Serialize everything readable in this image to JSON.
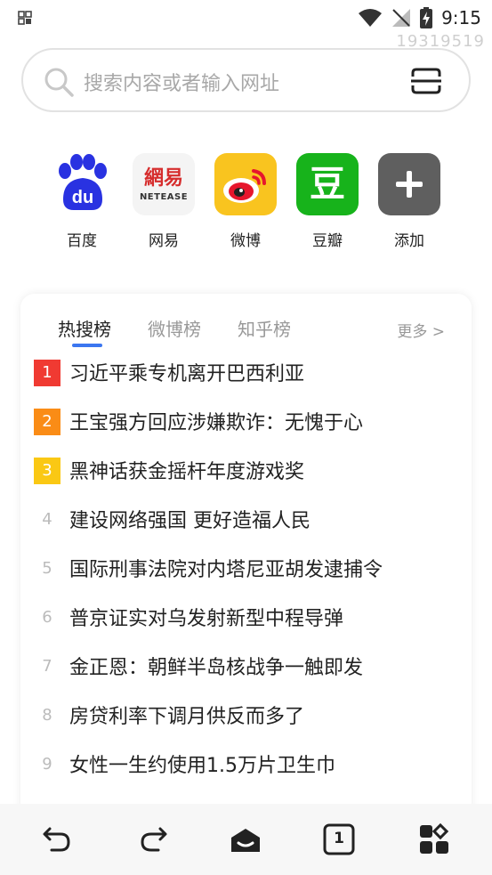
{
  "status_bar": {
    "time": "9:15"
  },
  "watermark": "19319519",
  "search": {
    "placeholder": "搜索内容或者输入网址"
  },
  "shortcuts": [
    {
      "label": "百度",
      "icon": "baidu-icon"
    },
    {
      "label": "网易",
      "icon": "netease-icon",
      "tile_text_top": "網易",
      "tile_text_bottom": "NETEASE"
    },
    {
      "label": "微博",
      "icon": "weibo-icon"
    },
    {
      "label": "豆瓣",
      "icon": "douban-icon",
      "tile_text": "豆"
    },
    {
      "label": "添加",
      "icon": "plus-icon"
    }
  ],
  "hot_list": {
    "tabs": [
      "热搜榜",
      "微博榜",
      "知乎榜"
    ],
    "more": "更多 >",
    "items": [
      {
        "rank": "1",
        "text": "习近平乘专机离开巴西利亚"
      },
      {
        "rank": "2",
        "text": "王宝强方回应涉嫌欺诈：无愧于心"
      },
      {
        "rank": "3",
        "text": "黑神话获金摇杆年度游戏奖"
      },
      {
        "rank": "4",
        "text": "建设网络强国 更好造福人民"
      },
      {
        "rank": "5",
        "text": "国际刑事法院对内塔尼亚胡发逮捕令"
      },
      {
        "rank": "6",
        "text": "普京证实对乌发射新型中程导弹"
      },
      {
        "rank": "7",
        "text": "金正恩：朝鲜半岛核战争一触即发"
      },
      {
        "rank": "8",
        "text": "房贷利率下调月供反而多了"
      },
      {
        "rank": "9",
        "text": "女性一生约使用1.5万片卫生巾"
      }
    ]
  },
  "bottom_nav": {
    "tab_count": "1"
  },
  "colors": {
    "rank1": "#f03a32",
    "rank2": "#fa8c16",
    "rank3": "#fac814",
    "accent": "#3b76f0"
  }
}
